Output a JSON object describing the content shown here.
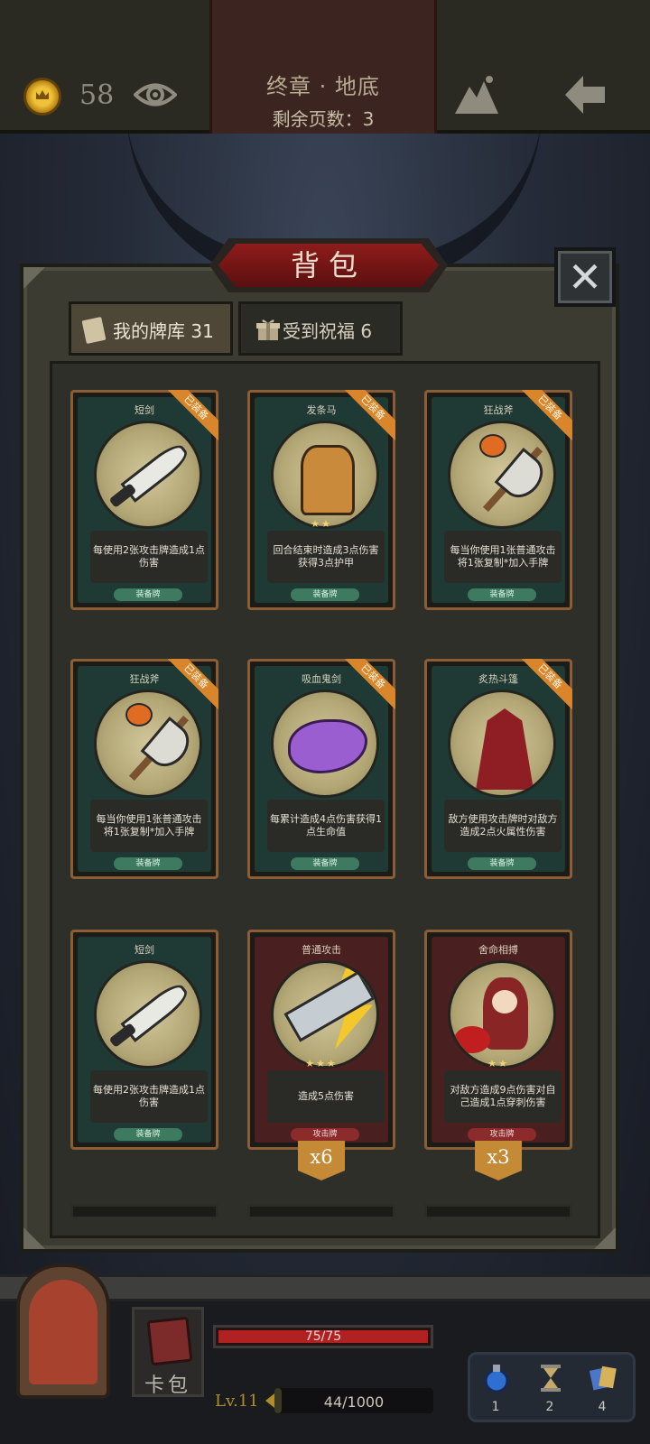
{
  "header": {
    "coins": "58",
    "chapter_title": "终章 · 地底",
    "pages_left": "剩余页数：3"
  },
  "panel": {
    "title": "背包",
    "close_label": "✕",
    "tabs": [
      {
        "label": "我的牌库 31",
        "active": true
      },
      {
        "label": "受到祝福 6",
        "active": false
      }
    ]
  },
  "cards": [
    {
      "name": "短剑",
      "desc": "每使用2张攻击牌造成1点伤害",
      "type": "装备牌",
      "equipped": "已装备",
      "stars": "",
      "art": "dagger"
    },
    {
      "name": "发条马",
      "desc": "回合结束时造成3点伤害获得3点护甲",
      "type": "装备牌",
      "equipped": "已装备",
      "stars": "★★",
      "art": "horse"
    },
    {
      "name": "狂战斧",
      "desc": "每当你使用1张普通攻击将1张复制*加入手牌",
      "type": "装备牌",
      "equipped": "已装备",
      "stars": "",
      "art": "axe"
    },
    {
      "name": "狂战斧",
      "desc": "每当你使用1张普通攻击将1张复制*加入手牌",
      "type": "装备牌",
      "equipped": "已装备",
      "stars": "",
      "art": "axe"
    },
    {
      "name": "吸血鬼剑",
      "desc": "每累计造成4点伤害获得1点生命值",
      "type": "装备牌",
      "equipped": "已装备",
      "stars": "",
      "art": "vamp"
    },
    {
      "name": "炙热斗篷",
      "desc": "敌方使用攻击牌时对敌方造成2点火属性伤害",
      "type": "装备牌",
      "equipped": "已装备",
      "stars": "",
      "art": "cloak"
    },
    {
      "name": "短剑",
      "desc": "每使用2张攻击牌造成1点伤害",
      "type": "装备牌",
      "equipped": "",
      "stars": "",
      "art": "dagger"
    },
    {
      "name": "普通攻击",
      "desc": "造成5点伤害",
      "type": "攻击牌",
      "equipped": "",
      "stars": "★★★",
      "art": "strike",
      "count": "x6"
    },
    {
      "name": "舍命相搏",
      "desc": "对敌方造成9点伤害对自己造成1点穿刺伤害",
      "type": "攻击牌",
      "equipped": "",
      "stars": "★★",
      "art": "hero",
      "count": "x3"
    }
  ],
  "footer": {
    "deck_label": "卡包",
    "hp_text": "75/75",
    "hp_fraction": 1.0,
    "level": "Lv.11",
    "xp_text": "44/1000",
    "xp_fraction": 0.044,
    "items": [
      {
        "icon": "potion-icon",
        "count": "1"
      },
      {
        "icon": "hourglass-icon",
        "count": "2"
      },
      {
        "icon": "cards-icon",
        "count": "4"
      }
    ]
  },
  "colors": {
    "equip_green": "#1f3a34",
    "attack_red": "#4a1f1f",
    "equipped_badge": "#d8852c",
    "hp_red": "#b02222",
    "gold": "#b08c2c"
  }
}
